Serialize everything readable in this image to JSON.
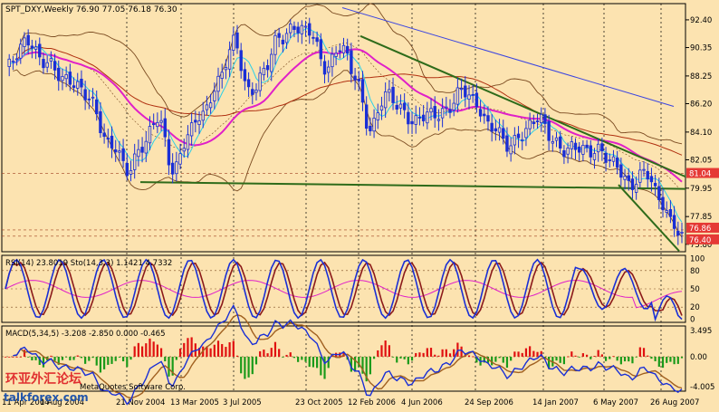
{
  "chart_data": {
    "type": "candlestick",
    "symbol": "SPT_DXY,Weekly",
    "ohlc_header": "76.90 77.05 76.18 76.30",
    "x_axis_labels": [
      "11 Apr 2004",
      "1 Aug 2004",
      "21 Nov 2004",
      "13 Mar 2005",
      "3 Jul 2005",
      "23 Oct 2005",
      "12 Feb 2006",
      "4 Jun 2006",
      "24 Sep 2006",
      "14 Jan 2007",
      "6 May 2007",
      "26 Aug 2007"
    ],
    "price_axis": {
      "ylim": [
        75.25,
        93.6
      ],
      "ticks": [
        92.4,
        90.35,
        88.25,
        86.2,
        84.1,
        82.05,
        79.95,
        77.85,
        75.8
      ],
      "markers": [
        {
          "label": "81.04",
          "value": 81.04,
          "bg": "#E53935"
        },
        {
          "label": "76.86",
          "value": 76.86,
          "bg": "#E53935"
        },
        {
          "label": "76.40",
          "value": 76.4,
          "bg": "#E53935"
        }
      ]
    },
    "stochastic": {
      "label": "RSI(14) 23.8019  Sto(14,3,3) 1.1421  4.7332",
      "ticks": [
        100,
        80,
        50,
        20,
        0
      ],
      "ylim": [
        -5,
        105
      ]
    },
    "macd": {
      "label": "MACD(5,34,5) -3.208 -2.850 0.000 -0.465",
      "ticks": [
        "3.495",
        "0.00",
        "-4.005"
      ],
      "ylim": [
        -4.6,
        4.1
      ]
    },
    "trendlines": [
      {
        "name": "upper-channel",
        "color": "#2E6B1A"
      },
      {
        "name": "lower-channel",
        "color": "#2E6B1A"
      },
      {
        "name": "support",
        "color": "#2E6B1A"
      }
    ],
    "colors": {
      "bull": "#1A2FD6",
      "bear": "#1A2FD6",
      "ma_magenta": "#E020C8",
      "ma_blue": "#3A44E0",
      "ma_darkred": "#B03010",
      "bollinger": "#7A4A20",
      "cyan": "#2BD0E8",
      "rsi": "#E020C8",
      "sto_k": "#1A2FD6",
      "sto_d": "#8B1A1A",
      "macd_pos": "#E01010",
      "macd_neg": "#1A9A1A",
      "macd_line": "#1A2FD6",
      "macd_signal": "#A06020"
    }
  },
  "watermark": {
    "text1": "环亚外汇论坛",
    "text2": "talkforex.com",
    "footer": "MetaQuotes Software Corp."
  }
}
